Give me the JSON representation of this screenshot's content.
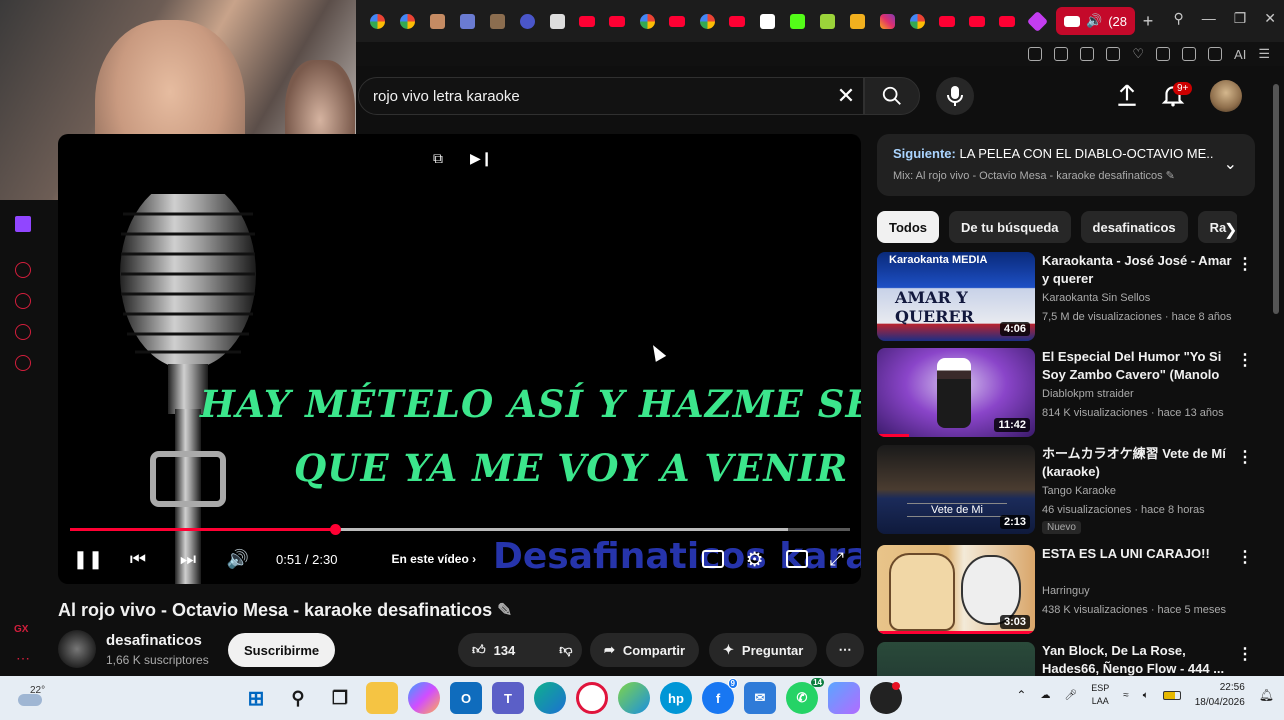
{
  "browser": {
    "active_tab_label": "(2œ",
    "active_tab_label_short": "(28",
    "new_tab_glyph": "+",
    "toolbar_ai": "AI"
  },
  "search": {
    "query": "rojo vivo letra karaoke"
  },
  "header": {
    "notif_badge": "9+"
  },
  "player": {
    "lyric_line_1": "Hay mételo así y hazme sentir",
    "lyric_line_2": "Que ya me voy a venir",
    "watermark": "Desafinaticos karaoke",
    "time": "0:51 / 2:30",
    "chapters_label": "En este vídeo",
    "progress_fraction": 0.34,
    "buffer_fraction": 0.92
  },
  "video": {
    "title": "Al rojo vivo - Octavio Mesa - karaoke desafinaticos",
    "channel": "desafinaticos",
    "subscribers": "1,66 K suscriptores",
    "subscribe_label": "Suscribirme",
    "likes": "134",
    "share_label": "Compartir",
    "ask_label": "Preguntar"
  },
  "up_next": {
    "prefix": "Siguiente:",
    "title": "LA PELEA CON EL DIABLO-OCTAVIO ME...",
    "mix": "Mix: Al rojo vivo - Octavio Mesa - karaoke desafinaticos"
  },
  "chips": [
    "Todos",
    "De tu búsqueda",
    "desafinaticos",
    "Ra"
  ],
  "recommendations": [
    {
      "title": "Karaokanta - José José - Amar y querer",
      "channel": "Karaokanta Sin Sellos",
      "stats": "7,5 M de visualizaciones · hace 8 años",
      "duration": "4:06",
      "thumb_text": "AMAR Y QUERER",
      "thumb_brand": "Karaokanta MEDIA"
    },
    {
      "title": "El Especial Del Humor \"Yo Si Soy Zambo Cavero\" (Manolo ...",
      "channel": "Diablokpm straider",
      "stats": "814 K visualizaciones · hace 13 años",
      "duration": "11:42"
    },
    {
      "title": "ホームカラオケ練習 Vete de Mí (karaoke)",
      "channel": "Tango Karaoke",
      "stats": "46 visualizaciones · hace 8 horas",
      "duration": "2:13",
      "badge": "Nuevo",
      "thumb_text": "Vete de Mi"
    },
    {
      "title": "ESTA ES LA UNI CARAJO!!",
      "channel": "Harringuy",
      "stats": "438 K visualizaciones · hace 5 meses",
      "duration": "3:03"
    },
    {
      "title": "Yan Block, De La Rose, Hades66, Ñengo Flow - 444 ...",
      "channel": "",
      "stats": "",
      "duration": ""
    }
  ],
  "taskbar": {
    "temperature": "22°",
    "lang_1": "ESP",
    "lang_2": "LAA",
    "time": "22:56",
    "date": "18/04/2026",
    "whatsapp_badge": "14",
    "facebook_badge": "9"
  },
  "colors": {
    "accent": "#ff0033",
    "lyric": "#3ce68c",
    "watermark": "#2d3ec9",
    "tab_active": "#c4092a"
  }
}
